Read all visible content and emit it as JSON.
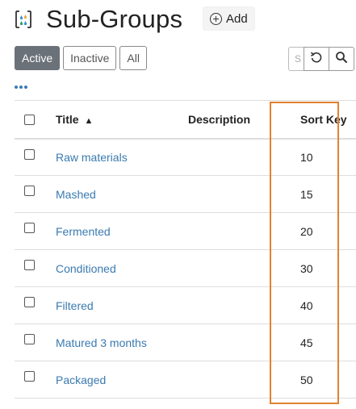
{
  "header": {
    "title": "Sub-Groups",
    "add_label": "Add",
    "app_icon": "sub-groups-app-icon"
  },
  "filters": {
    "active": "Active",
    "inactive": "Inactive",
    "all": "All",
    "selected": "Active"
  },
  "search": {
    "value": "S",
    "reset_icon": "reset-icon",
    "search_icon": "search-icon"
  },
  "more_menu_icon": "more-dots-icon",
  "table": {
    "columns": {
      "title": "Title",
      "title_sort_indicator": "▲",
      "description": "Description",
      "sort_key": "Sort Key"
    },
    "rows": [
      {
        "title": "Raw materials",
        "description": "",
        "sort_key": "10"
      },
      {
        "title": "Mashed",
        "description": "",
        "sort_key": "15"
      },
      {
        "title": "Fermented",
        "description": "",
        "sort_key": "20"
      },
      {
        "title": "Conditioned",
        "description": "",
        "sort_key": "30"
      },
      {
        "title": "Filtered",
        "description": "",
        "sort_key": "40"
      },
      {
        "title": "Matured 3 months",
        "description": "",
        "sort_key": "45"
      },
      {
        "title": "Packaged",
        "description": "",
        "sort_key": "50"
      }
    ]
  },
  "colors": {
    "link": "#3a7ab0",
    "active_filter_bg": "#6b7178",
    "highlight": "#e0822e"
  }
}
